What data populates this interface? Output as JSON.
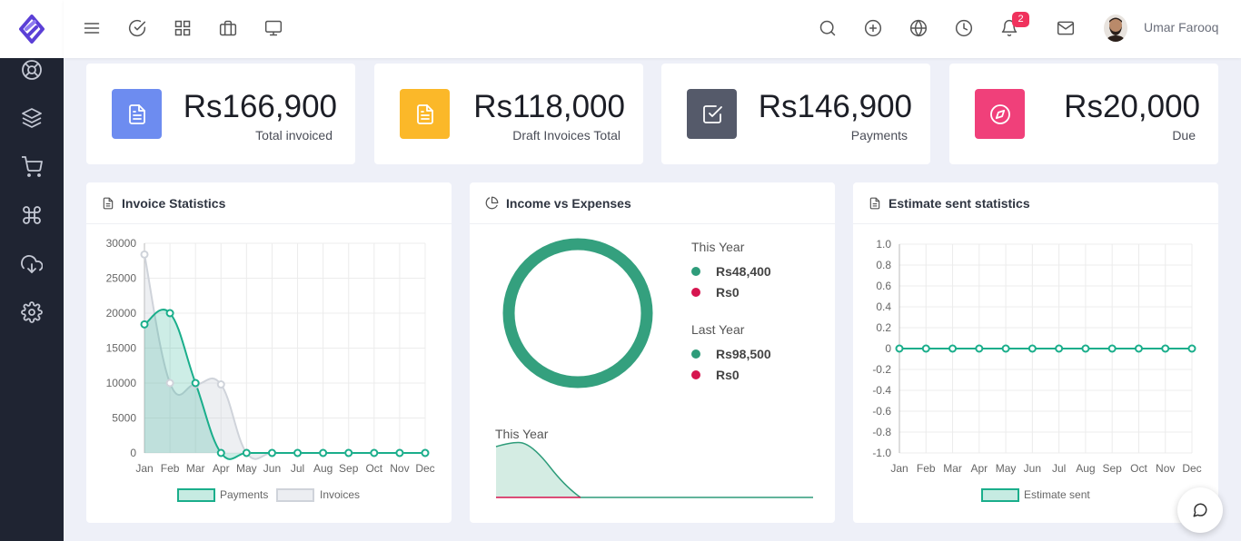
{
  "header": {
    "user_name": "Umar Farooq",
    "notification_count": "2",
    "left_icons": [
      "menu-icon",
      "check-circle-icon",
      "grid-icon",
      "briefcase-icon",
      "monitor-icon"
    ],
    "right_icons": [
      "search-icon",
      "plus-circle-icon",
      "globe-icon",
      "clock-icon",
      "bell-icon",
      "mail-icon"
    ]
  },
  "sidebar": {
    "icons": [
      "lifebuoy-icon",
      "layers-icon",
      "cart-icon",
      "command-icon",
      "cloud-download-icon",
      "settings-icon"
    ]
  },
  "stats": [
    {
      "value": "Rs166,900",
      "label": "Total invoiced",
      "color": "#6d8cf0",
      "icon": "file-text-icon"
    },
    {
      "value": "Rs118,000",
      "label": "Draft Invoices Total",
      "color": "#fbb829",
      "icon": "file-text-icon"
    },
    {
      "value": "Rs146,900",
      "label": "Payments",
      "color": "#555a6a",
      "icon": "check-square-icon"
    },
    {
      "value": "Rs20,000",
      "label": "Due",
      "color": "#f0407a",
      "icon": "compass-icon"
    }
  ],
  "invoice_panel": {
    "title": "Invoice Statistics"
  },
  "income_panel": {
    "title": "Income vs Expenses",
    "this_year_label": "This Year",
    "this_year_income": "Rs48,400",
    "this_year_expense": "Rs0",
    "last_year_label": "Last Year",
    "last_year_income": "Rs98,500",
    "last_year_expense": "Rs0",
    "sparkline_label": "This Year",
    "income_color": "#2e9c7a",
    "expense_color": "#d6154f"
  },
  "estimate_panel": {
    "title": "Estimate sent statistics"
  },
  "chart_data": [
    {
      "type": "line",
      "title": "Invoice Statistics",
      "categories": [
        "Jan",
        "Feb",
        "Mar",
        "Apr",
        "May",
        "Jun",
        "Jul",
        "Aug",
        "Sep",
        "Oct",
        "Nov",
        "Dec"
      ],
      "series": [
        {
          "name": "Payments",
          "values": [
            18400,
            20000,
            10000,
            0,
            0,
            0,
            0,
            0,
            0,
            0,
            0,
            0
          ],
          "color": "#1aae8b"
        },
        {
          "name": "Invoices",
          "values": [
            28400,
            10000,
            9800,
            9800,
            0,
            0,
            0,
            0,
            0,
            0,
            0,
            0
          ],
          "color": "#cfd3da"
        }
      ],
      "ylim": [
        0,
        30000
      ],
      "yticks": [
        "30000",
        "25000",
        "20000",
        "15000",
        "10000",
        "5000",
        "0"
      ],
      "grid": true,
      "legend": "bottom"
    },
    {
      "type": "pie",
      "title": "Income vs Expenses",
      "categories": [
        "Income",
        "Expenses"
      ],
      "values": [
        48400,
        0
      ]
    },
    {
      "type": "line",
      "title": "Estimate sent statistics",
      "categories": [
        "Jan",
        "Feb",
        "Mar",
        "Apr",
        "May",
        "Jun",
        "Jul",
        "Aug",
        "Sep",
        "Oct",
        "Nov",
        "Dec"
      ],
      "series": [
        {
          "name": "Estimate sent",
          "values": [
            0,
            0,
            0,
            0,
            0,
            0,
            0,
            0,
            0,
            0,
            0,
            0
          ],
          "color": "#1aae8b"
        }
      ],
      "ylim": [
        -1.0,
        1.0
      ],
      "yticks": [
        "1.0",
        "0.8",
        "0.6",
        "0.4",
        "0.2",
        "0",
        "-0.2",
        "-0.4",
        "-0.6",
        "-0.8",
        "-1.0"
      ],
      "grid": true,
      "legend": "bottom"
    }
  ]
}
